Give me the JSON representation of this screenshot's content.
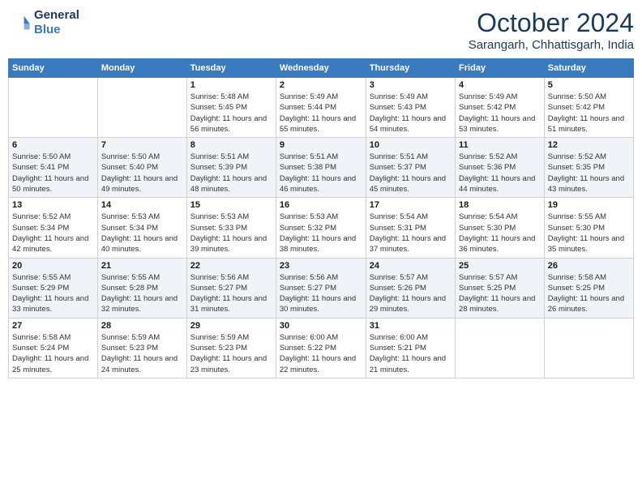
{
  "header": {
    "logo": {
      "general": "General",
      "blue": "Blue"
    },
    "month": "October 2024",
    "location": "Sarangarh, Chhattisgarh, India"
  },
  "weekdays": [
    "Sunday",
    "Monday",
    "Tuesday",
    "Wednesday",
    "Thursday",
    "Friday",
    "Saturday"
  ],
  "weeks": [
    [
      {
        "day": "",
        "info": ""
      },
      {
        "day": "",
        "info": ""
      },
      {
        "day": "1",
        "info": "Sunrise: 5:48 AM\nSunset: 5:45 PM\nDaylight: 11 hours and 56 minutes."
      },
      {
        "day": "2",
        "info": "Sunrise: 5:49 AM\nSunset: 5:44 PM\nDaylight: 11 hours and 55 minutes."
      },
      {
        "day": "3",
        "info": "Sunrise: 5:49 AM\nSunset: 5:43 PM\nDaylight: 11 hours and 54 minutes."
      },
      {
        "day": "4",
        "info": "Sunrise: 5:49 AM\nSunset: 5:42 PM\nDaylight: 11 hours and 53 minutes."
      },
      {
        "day": "5",
        "info": "Sunrise: 5:50 AM\nSunset: 5:42 PM\nDaylight: 11 hours and 51 minutes."
      }
    ],
    [
      {
        "day": "6",
        "info": "Sunrise: 5:50 AM\nSunset: 5:41 PM\nDaylight: 11 hours and 50 minutes."
      },
      {
        "day": "7",
        "info": "Sunrise: 5:50 AM\nSunset: 5:40 PM\nDaylight: 11 hours and 49 minutes."
      },
      {
        "day": "8",
        "info": "Sunrise: 5:51 AM\nSunset: 5:39 PM\nDaylight: 11 hours and 48 minutes."
      },
      {
        "day": "9",
        "info": "Sunrise: 5:51 AM\nSunset: 5:38 PM\nDaylight: 11 hours and 46 minutes."
      },
      {
        "day": "10",
        "info": "Sunrise: 5:51 AM\nSunset: 5:37 PM\nDaylight: 11 hours and 45 minutes."
      },
      {
        "day": "11",
        "info": "Sunrise: 5:52 AM\nSunset: 5:36 PM\nDaylight: 11 hours and 44 minutes."
      },
      {
        "day": "12",
        "info": "Sunrise: 5:52 AM\nSunset: 5:35 PM\nDaylight: 11 hours and 43 minutes."
      }
    ],
    [
      {
        "day": "13",
        "info": "Sunrise: 5:52 AM\nSunset: 5:34 PM\nDaylight: 11 hours and 42 minutes."
      },
      {
        "day": "14",
        "info": "Sunrise: 5:53 AM\nSunset: 5:34 PM\nDaylight: 11 hours and 40 minutes."
      },
      {
        "day": "15",
        "info": "Sunrise: 5:53 AM\nSunset: 5:33 PM\nDaylight: 11 hours and 39 minutes."
      },
      {
        "day": "16",
        "info": "Sunrise: 5:53 AM\nSunset: 5:32 PM\nDaylight: 11 hours and 38 minutes."
      },
      {
        "day": "17",
        "info": "Sunrise: 5:54 AM\nSunset: 5:31 PM\nDaylight: 11 hours and 37 minutes."
      },
      {
        "day": "18",
        "info": "Sunrise: 5:54 AM\nSunset: 5:30 PM\nDaylight: 11 hours and 36 minutes."
      },
      {
        "day": "19",
        "info": "Sunrise: 5:55 AM\nSunset: 5:30 PM\nDaylight: 11 hours and 35 minutes."
      }
    ],
    [
      {
        "day": "20",
        "info": "Sunrise: 5:55 AM\nSunset: 5:29 PM\nDaylight: 11 hours and 33 minutes."
      },
      {
        "day": "21",
        "info": "Sunrise: 5:55 AM\nSunset: 5:28 PM\nDaylight: 11 hours and 32 minutes."
      },
      {
        "day": "22",
        "info": "Sunrise: 5:56 AM\nSunset: 5:27 PM\nDaylight: 11 hours and 31 minutes."
      },
      {
        "day": "23",
        "info": "Sunrise: 5:56 AM\nSunset: 5:27 PM\nDaylight: 11 hours and 30 minutes."
      },
      {
        "day": "24",
        "info": "Sunrise: 5:57 AM\nSunset: 5:26 PM\nDaylight: 11 hours and 29 minutes."
      },
      {
        "day": "25",
        "info": "Sunrise: 5:57 AM\nSunset: 5:25 PM\nDaylight: 11 hours and 28 minutes."
      },
      {
        "day": "26",
        "info": "Sunrise: 5:58 AM\nSunset: 5:25 PM\nDaylight: 11 hours and 26 minutes."
      }
    ],
    [
      {
        "day": "27",
        "info": "Sunrise: 5:58 AM\nSunset: 5:24 PM\nDaylight: 11 hours and 25 minutes."
      },
      {
        "day": "28",
        "info": "Sunrise: 5:59 AM\nSunset: 5:23 PM\nDaylight: 11 hours and 24 minutes."
      },
      {
        "day": "29",
        "info": "Sunrise: 5:59 AM\nSunset: 5:23 PM\nDaylight: 11 hours and 23 minutes."
      },
      {
        "day": "30",
        "info": "Sunrise: 6:00 AM\nSunset: 5:22 PM\nDaylight: 11 hours and 22 minutes."
      },
      {
        "day": "31",
        "info": "Sunrise: 6:00 AM\nSunset: 5:21 PM\nDaylight: 11 hours and 21 minutes."
      },
      {
        "day": "",
        "info": ""
      },
      {
        "day": "",
        "info": ""
      }
    ]
  ]
}
